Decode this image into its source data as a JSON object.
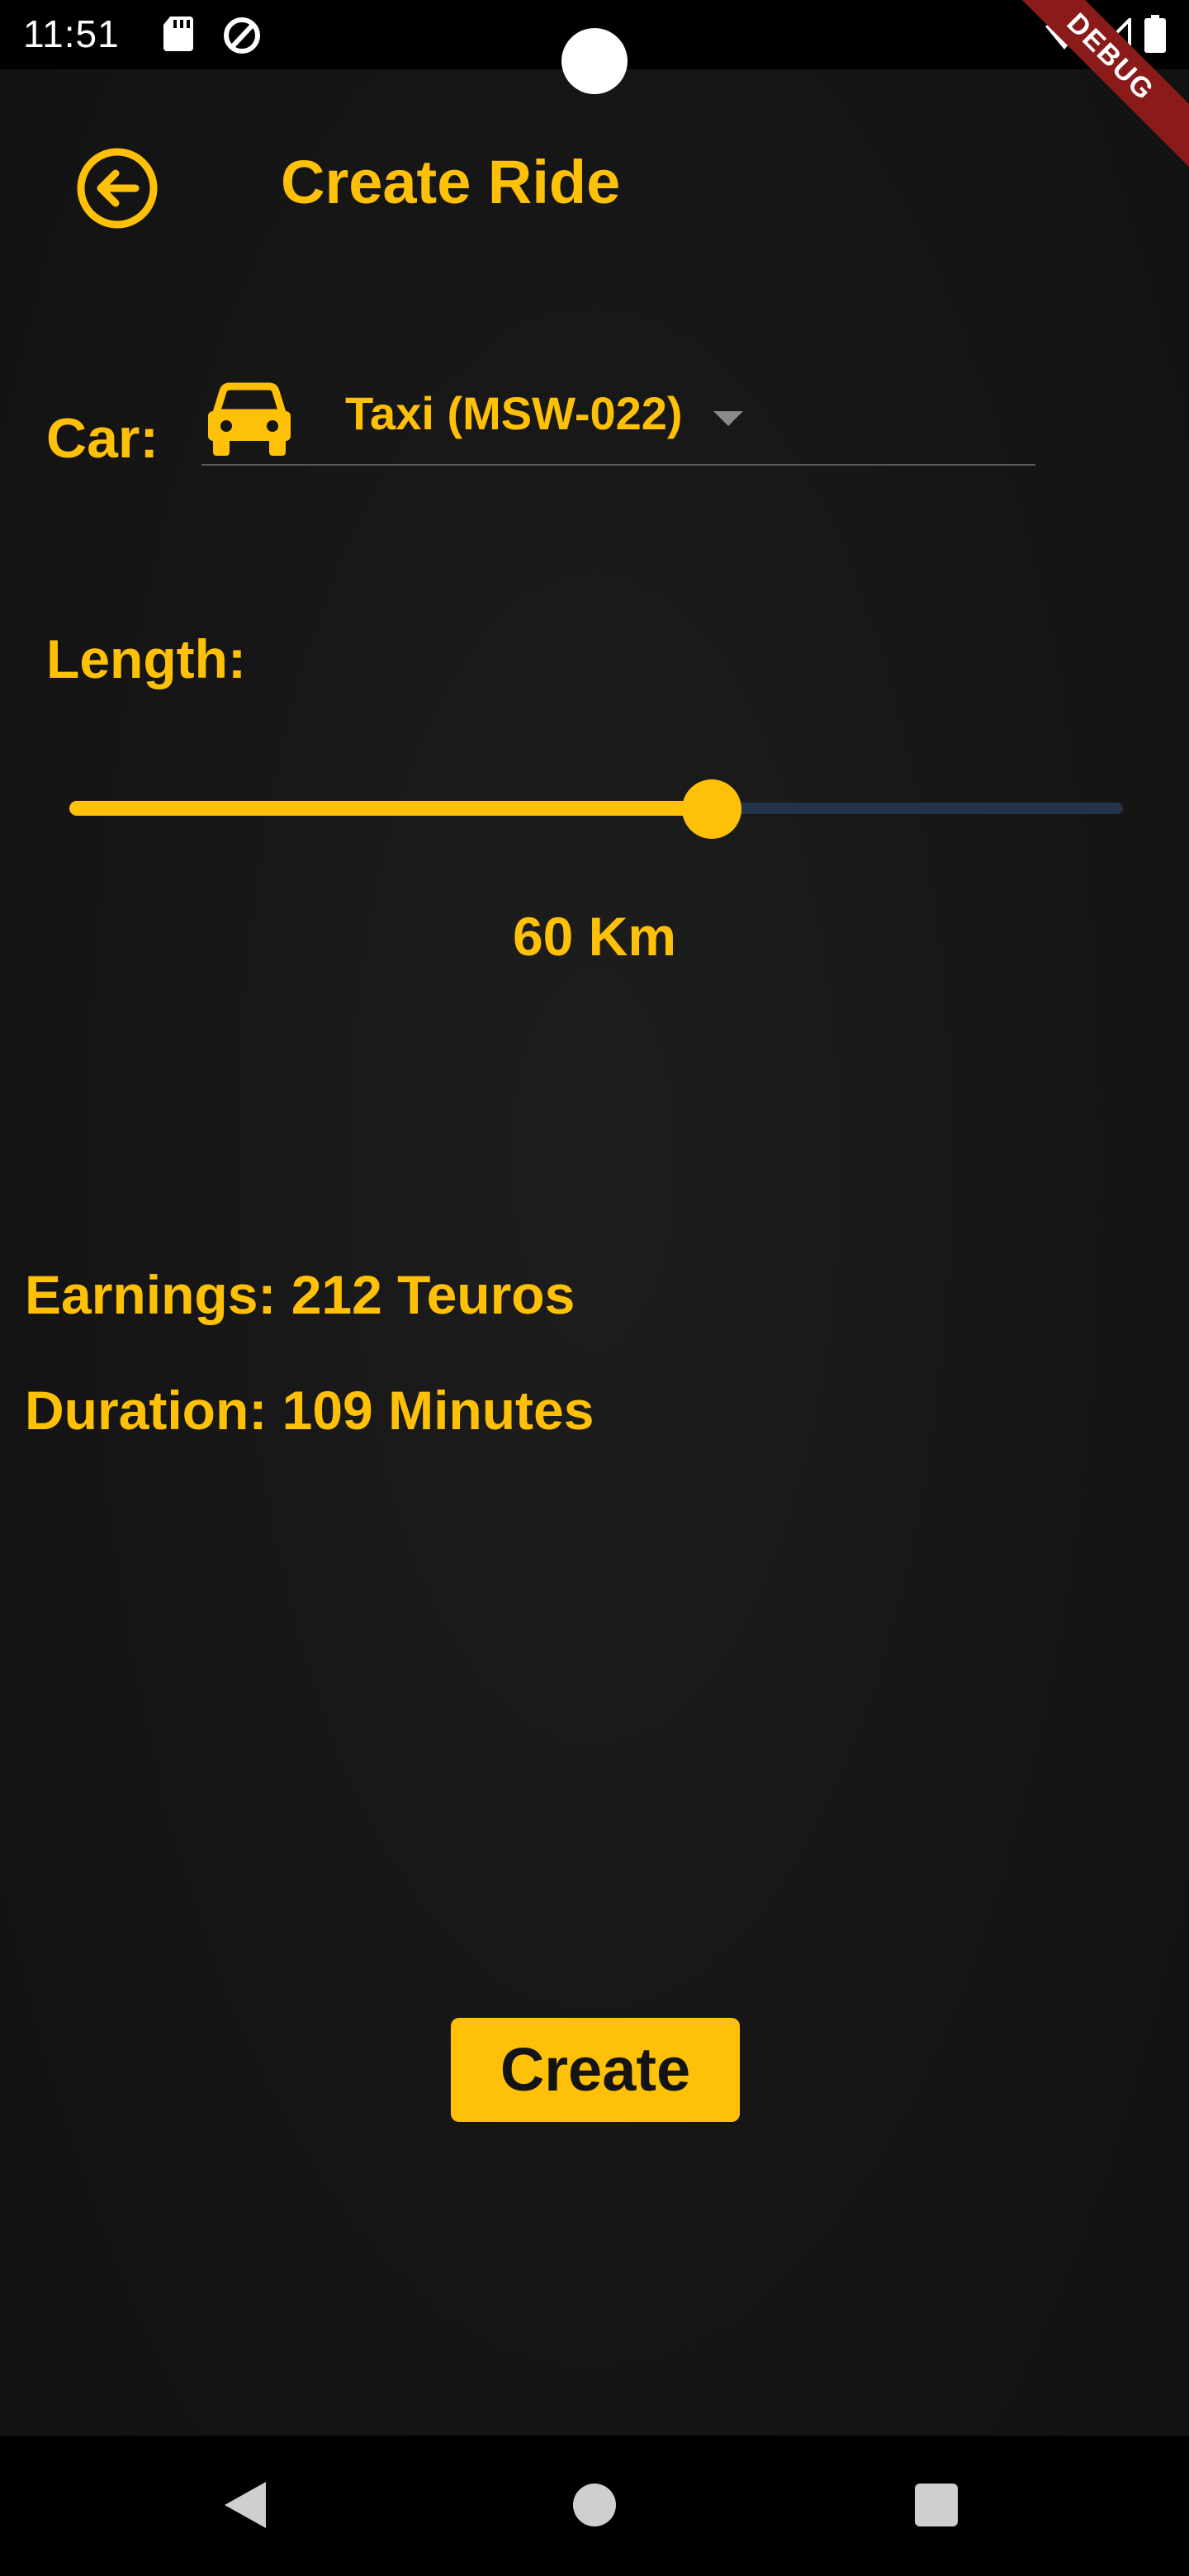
{
  "status_bar": {
    "time": "11:51"
  },
  "debug_banner": "DEBUG",
  "header": {
    "title": "Create Ride",
    "back_icon": "arrow-circle-left-icon"
  },
  "car": {
    "label": "Car:",
    "selected": "Taxi (MSW-022)",
    "icon": "car-icon"
  },
  "length": {
    "label": "Length:",
    "value_text": "60 Km",
    "slider_fraction": 0.61
  },
  "info": {
    "earnings": "Earnings: 212 Teuros",
    "duration": "Duration: 109 Minutes"
  },
  "actions": {
    "create_label": "Create"
  },
  "colors": {
    "accent": "#ffc107",
    "background": "#151515",
    "slider_inactive": "#243347"
  }
}
